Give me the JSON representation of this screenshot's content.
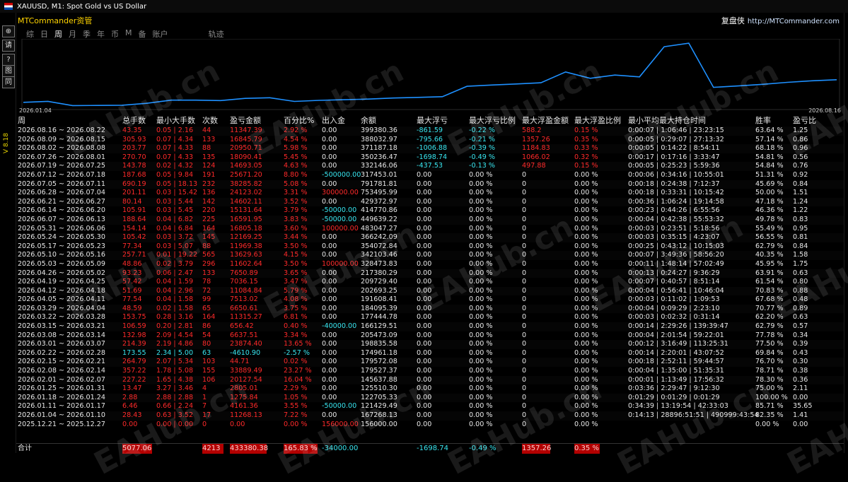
{
  "window": {
    "title": "XAUUSD, M1:  Spot Gold vs US Dollar"
  },
  "app": {
    "title": "MTCommander资管",
    "brand_cn": "复盘侠",
    "brand_url": "http://MTCommander.com",
    "version": "V 8.18"
  },
  "toolbar": {
    "buttons": [
      "⊕",
      "请",
      "?",
      "图",
      "同"
    ]
  },
  "tabs": [
    {
      "label": "综",
      "active": false
    },
    {
      "label": "日",
      "active": false
    },
    {
      "label": "周",
      "active": true
    },
    {
      "label": "月",
      "active": false
    },
    {
      "label": "季",
      "active": false
    },
    {
      "label": "年",
      "active": false
    },
    {
      "label": "币",
      "active": false
    },
    {
      "label": "M",
      "active": false
    },
    {
      "label": "备",
      "active": false
    },
    {
      "label": "账户",
      "active": false
    },
    {
      "label": "轨迹",
      "active": false
    }
  ],
  "chart_data": {
    "type": "line",
    "start_label": "2026.01.04",
    "end_label": "2026.08.16",
    "color": "#1e90ff",
    "values": [
      156000,
      167268,
      121429,
      122705,
      125510,
      145638,
      179527,
      179572,
      174961,
      198835,
      205473,
      166129,
      177445,
      184095,
      191608,
      202693,
      209729,
      217380,
      328474,
      342103,
      354073,
      366242,
      483047,
      414771,
      449639,
      429373,
      753496,
      791781,
      317453,
      332146,
      350236,
      371188,
      388032,
      399380
    ]
  },
  "table": {
    "headers": [
      "周",
      "总手数",
      "最小大手数",
      "次数",
      "盈亏金额",
      "百分比%",
      "出入金",
      "余额",
      "最大浮亏",
      "最大浮亏比例",
      "最大浮盈金额",
      "最大浮盈比例",
      "最小平均最大持仓时间",
      "胜率",
      "盈亏比"
    ],
    "rows": [
      [
        "2026.08.16 ~ 2026.08.22",
        "43.35",
        "0.05 | 2.16",
        "44",
        "11347.39",
        "2.92 %",
        "0.00",
        "399380.36",
        "-861.59",
        "-0.22 %",
        "588.2",
        "0.15 %",
        "0:00:07 | 1:06:46 | 23:23:15",
        "63.64 %",
        "1.25"
      ],
      [
        "2026.08.09 ~ 2026.08.15",
        "305.93",
        "0.07 | 4.34",
        "133",
        "16845.79",
        "4.54 %",
        "0.00",
        "388032.97",
        "-795.66",
        "-0.21 %",
        "1357.26",
        "0.35 %",
        "0:00:05 | 0:29:07 | 27:13:32",
        "57.14 %",
        "0.86"
      ],
      [
        "2026.08.02 ~ 2026.08.08",
        "203.77",
        "0.07 | 4.33",
        "88",
        "20950.71",
        "5.98 %",
        "0.00",
        "371187.18",
        "-1006.88",
        "-0.39 %",
        "1184.83",
        "0.33 %",
        "0:00:05 | 0:14:22 | 8:54:11",
        "68.18 %",
        "0.96"
      ],
      [
        "2026.07.26 ~ 2026.08.01",
        "270.70",
        "0.07 | 4.33",
        "135",
        "18090.41",
        "5.45 %",
        "0.00",
        "350236.47",
        "-1698.74",
        "-0.49 %",
        "1066.02",
        "0.32 %",
        "0:00:17 | 0:17:16 | 3:33:47",
        "54.81 %",
        "0.56"
      ],
      [
        "2026.07.19 ~ 2026.07.25",
        "143.78",
        "0.02 | 4.32",
        "124",
        "14693.05",
        "4.63 %",
        "0.00",
        "332146.06",
        "-437.53",
        "-0.13 %",
        "497.88",
        "0.15 %",
        "0:00:05 | 0:25:23 | 5:59:36",
        "54.84 %",
        "0.76"
      ],
      [
        "2026.07.12 ~ 2026.07.18",
        "187.68",
        "0.05 | 9.84",
        "191",
        "25671.20",
        "8.80 %",
        "-500000.00",
        "317453.01",
        "0.00",
        "0.00 %",
        "0",
        "0.00 %",
        "0:00:06 | 0:34:16 | 10:55:01",
        "51.31 %",
        "0.92"
      ],
      [
        "2026.07.05 ~ 2026.07.11",
        "690.19",
        "0.05 | 18.13",
        "232",
        "38285.82",
        "5.08 %",
        "0.00",
        "791781.81",
        "0.00",
        "0.00 %",
        "0",
        "0.00 %",
        "0:00:18 | 0:24:38 | 7:12:37",
        "45.69 %",
        "0.84"
      ],
      [
        "2026.06.28 ~ 2026.07.04",
        "201.11",
        "0.03 | 15.42",
        "136",
        "24123.02",
        "3.31 %",
        "300000.00",
        "753495.99",
        "0.00",
        "0.00 %",
        "0",
        "0.00 %",
        "0:00:18 | 0:33:31 | 10:15:42",
        "50.00 %",
        "1.51"
      ],
      [
        "2026.06.21 ~ 2026.06.27",
        "80.14",
        "0.03 | 5.44",
        "142",
        "14602.11",
        "3.52 %",
        "0.00",
        "429372.97",
        "0.00",
        "0.00 %",
        "0",
        "0.00 %",
        "0:00:36 | 1:06:24 | 19:14:58",
        "47.18 %",
        "1.24"
      ],
      [
        "2026.06.14 ~ 2026.06.20",
        "105.91",
        "0.03 | 5.45",
        "220",
        "15131.64",
        "3.79 %",
        "-50000.00",
        "414770.86",
        "0.00",
        "0.00 %",
        "0",
        "0.00 %",
        "0:00:23 | 0:44:26 | 6:55:56",
        "46.36 %",
        "1.22"
      ],
      [
        "2026.06.07 ~ 2026.06.13",
        "188.64",
        "0.04 | 6.82",
        "225",
        "16591.95",
        "3.83 %",
        "-50000.00",
        "449639.22",
        "0.00",
        "0.00 %",
        "0",
        "0.00 %",
        "0:00:04 | 0:42:38 | 55:53:32",
        "49.78 %",
        "0.83"
      ],
      [
        "2026.05.31 ~ 2026.06.06",
        "154.14",
        "0.04 | 6.84",
        "164",
        "16805.18",
        "3.60 %",
        "100000.00",
        "483047.27",
        "0.00",
        "0.00 %",
        "0",
        "0.00 %",
        "0:00:03 | 0:23:51 | 5:18:56",
        "55.49 %",
        "0.95"
      ],
      [
        "2026.05.24 ~ 2026.05.30",
        "105.42",
        "0.03 | 3.72",
        "145",
        "12169.25",
        "3.44 %",
        "0.00",
        "366242.09",
        "0.00",
        "0.00 %",
        "0",
        "0.00 %",
        "0:00:03 | 0:35:15 | 4:23:07",
        "56.55 %",
        "0.81"
      ],
      [
        "2026.05.17 ~ 2026.05.23",
        "77.34",
        "0.03 | 5.07",
        "88",
        "11969.38",
        "3.50 %",
        "0.00",
        "354072.84",
        "0.00",
        "0.00 %",
        "0",
        "0.00 %",
        "0:00:25 | 0:43:12 | 10:15:03",
        "62.79 %",
        "0.84"
      ],
      [
        "2026.05.10 ~ 2026.05.16",
        "257.71",
        "0.01 | 19.22",
        "565",
        "13629.63",
        "4.15 %",
        "0.00",
        "342103.46",
        "0.00",
        "0.00 %",
        "0",
        "0.00 %",
        "0:00:07 | 3:49:36 | 58:56:20",
        "40.35 %",
        "1.58"
      ],
      [
        "2026.05.03 ~ 2026.05.09",
        "48.86",
        "0.02 | 3.79",
        "296",
        "11602.64",
        "3.50 %",
        "100000.00",
        "328473.83",
        "0.00",
        "0.00 %",
        "0",
        "0.00 %",
        "0:00:11 | 1:48:14 | 57:02:49",
        "45.95 %",
        "1.75"
      ],
      [
        "2026.04.26 ~ 2026.05.02",
        "93.23",
        "0.06 | 2.47",
        "133",
        "7650.89",
        "3.65 %",
        "0.00",
        "217380.29",
        "0.00",
        "0.00 %",
        "0",
        "0.00 %",
        "0:00:13 | 0:24:27 | 9:36:29",
        "63.91 %",
        "0.63"
      ],
      [
        "2026.04.19 ~ 2026.04.25",
        "57.42",
        "0.04 | 1.59",
        "78",
        "7036.15",
        "3.47 %",
        "0.00",
        "209729.40",
        "0.00",
        "0.00 %",
        "0",
        "0.00 %",
        "0:00:07 | 0:40:57 | 8:51:14",
        "61.54 %",
        "0.80"
      ],
      [
        "2026.04.12 ~ 2026.04.18",
        "51.69",
        "0.04 | 2.96",
        "72",
        "11084.84",
        "5.79 %",
        "0.00",
        "202693.25",
        "0.00",
        "0.00 %",
        "0",
        "0.00 %",
        "0:00:04 | 0:56:41 | 10:46:04",
        "70.83 %",
        "0.88"
      ],
      [
        "2026.04.05 ~ 2026.04.11",
        "77.54",
        "0.04 | 1.58",
        "99",
        "7513.02",
        "4.08 %",
        "0.00",
        "191608.41",
        "0.00",
        "0.00 %",
        "0",
        "0.00 %",
        "0:00:03 | 0:11:02 | 1:09:53",
        "67.68 %",
        "0.48"
      ],
      [
        "2026.03.29 ~ 2026.04.04",
        "48.59",
        "0.02 | 1.58",
        "65",
        "6650.61",
        "3.75 %",
        "0.00",
        "184095.39",
        "0.00",
        "0.00 %",
        "0",
        "0.00 %",
        "0:00:04 | 0:09:29 | 2:23:10",
        "70.77 %",
        "0.89"
      ],
      [
        "2026.03.22 ~ 2026.03.28",
        "153.75",
        "0.28 | 3.16",
        "164",
        "11315.27",
        "6.81 %",
        "0.00",
        "177444.78",
        "0.00",
        "0.00 %",
        "0",
        "0.00 %",
        "0:00:03 | 0:02:32 | 0:31:14",
        "62.20 %",
        "0.63"
      ],
      [
        "2026.03.15 ~ 2026.03.21",
        "106.59",
        "0.20 | 2.81",
        "86",
        "656.42",
        "0.40 %",
        "-40000.00",
        "166129.51",
        "0.00",
        "0.00 %",
        "0",
        "0.00 %",
        "0:00:14 | 2:29:26 | 139:39:47",
        "62.79 %",
        "0.57"
      ],
      [
        "2026.03.08 ~ 2026.03.14",
        "132.98",
        "2.09 | 4.54",
        "54",
        "6637.51",
        "3.34 %",
        "0.00",
        "205473.09",
        "0.00",
        "0.00 %",
        "0",
        "0.00 %",
        "0:00:04 | 2:01:54 | 59:22:01",
        "77.78 %",
        "0.34"
      ],
      [
        "2026.03.01 ~ 2026.03.07",
        "214.39",
        "2.19 | 4.86",
        "80",
        "23874.40",
        "13.65 %",
        "0.00",
        "198835.58",
        "0.00",
        "0.00 %",
        "0",
        "0.00 %",
        "0:00:12 | 3:16:49 | 113:25:31",
        "77.50 %",
        "0.39"
      ],
      [
        "2026.02.22 ~ 2026.02.28",
        "173.55",
        "2.34 | 5.00",
        "63",
        "-4610.90",
        "-2.57 %",
        "0.00",
        "174961.18",
        "0.00",
        "0.00 %",
        "0",
        "0.00 %",
        "0:00:14 | 2:20:01 | 43:07:52",
        "69.84 %",
        "0.43"
      ],
      [
        "2026.02.15 ~ 2026.02.21",
        "264.79",
        "2.07 | 5.34",
        "103",
        "44.71",
        "0.02 %",
        "0.00",
        "179572.08",
        "0.00",
        "0.00 %",
        "0",
        "0.00 %",
        "0:00:18 | 2:52:11 | 59:44:57",
        "76.70 %",
        "0.30"
      ],
      [
        "2026.02.08 ~ 2026.02.14",
        "357.22",
        "1.78 | 5.08",
        "155",
        "33889.49",
        "23.27 %",
        "0.00",
        "179527.37",
        "0.00",
        "0.00 %",
        "0",
        "0.00 %",
        "0:00:04 | 1:35:00 | 51:35:31",
        "78.71 %",
        "0.38"
      ],
      [
        "2026.02.01 ~ 2026.02.07",
        "227.22",
        "1.65 | 4.38",
        "106",
        "20127.54",
        "16.04 %",
        "0.00",
        "145637.88",
        "0.00",
        "0.00 %",
        "0",
        "0.00 %",
        "0:00:01 | 1:13:49 | 17:56:32",
        "78.30 %",
        "0.36"
      ],
      [
        "2026.01.25 ~ 2026.01.31",
        "13.47",
        "3.27 | 3.46",
        "4",
        "2805.01",
        "2.29 %",
        "0.00",
        "125510.30",
        "0.00",
        "0.00 %",
        "0",
        "0.00 %",
        "0:03:36 | 2:29:47 | 9:12:30",
        "75.00 %",
        "2.11"
      ],
      [
        "2026.01.18 ~ 2026.01.24",
        "2.88",
        "2.88 | 2.88",
        "1",
        "1275.84",
        "1.05 %",
        "0.00",
        "122705.33",
        "0.00",
        "0.00 %",
        "0",
        "0.00 %",
        "0:01:29 | 0:01:29 | 0:01:29",
        "100.00 %",
        "0.00"
      ],
      [
        "2026.01.11 ~ 2026.01.17",
        "6.46",
        "0.66 | 2.24",
        "7",
        "4161.36",
        "3.55 %",
        "-50000.00",
        "121429.49",
        "0.00",
        "0.00 %",
        "0",
        "0.00 %",
        "0:34:39 | 13:19:54 | 42:33:03",
        "85.71 %",
        "35.65"
      ],
      [
        "2026.01.04 ~ 2026.01.10",
        "28.43",
        "0.63 | 3.52",
        "17",
        "11268.13",
        "7.22 %",
        "0.00",
        "167268.13",
        "0.00",
        "0.00 %",
        "0",
        "0.00 %",
        "0:14:13 | 28896:51:51 | 490999:43:54",
        "82.35 %",
        "1.41"
      ],
      [
        "2025.12.21 ~ 2025.12.27",
        "0.00",
        "0.00 | 0.00",
        "0",
        "0.00",
        "0.00 %",
        "156000.00",
        "156000.00",
        "0.00",
        "0.00 %",
        "0",
        "0.00 %",
        "",
        "0.00 %",
        "0.00"
      ]
    ],
    "total": {
      "label": "合计",
      "lots": "5077.06",
      "trades": "4213",
      "profit": "433380.38",
      "percent": "165.83 %",
      "flow": "-34000.00",
      "max_float_loss": "-1698.74",
      "max_float_loss_pct": "-0.49 %",
      "max_float_profit": "1357.26",
      "max_float_profit_pct": "0.35 %"
    }
  },
  "watermark": "EAHub.cn"
}
